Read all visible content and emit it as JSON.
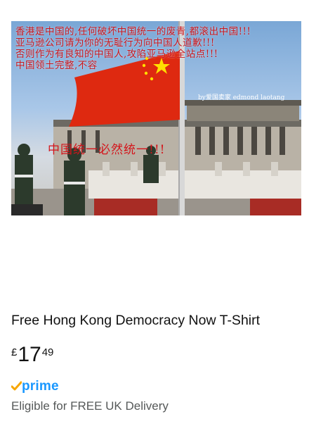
{
  "product": {
    "image": {
      "overlay_lines": [
        "香港是中国的,任何破坏中国统一的废青,都滚出中国!!!",
        "亚马逊公司请为你的无耻行为向中国人道歉!!!",
        "否则作为有良知的中国人,攻陷亚马逊全站点!!!",
        "中国领土完整,不容"
      ],
      "credit": "by爱国卖家 edmond laotang",
      "bottom_overlay": "中国统一必然统一!!!",
      "colors": {
        "overlay_text": "#c8161d",
        "flag_red": "#de2910",
        "flag_star": "#ffde00"
      }
    },
    "title": "Free Hong Kong Democracy Now T-Shirt",
    "price": {
      "currency_symbol": "£",
      "whole": "17",
      "fraction": "49"
    },
    "prime": {
      "label": "prime",
      "check_icon": "prime-check-icon",
      "color": "#1a98ff"
    },
    "delivery_text": "Eligible for FREE UK Delivery"
  }
}
